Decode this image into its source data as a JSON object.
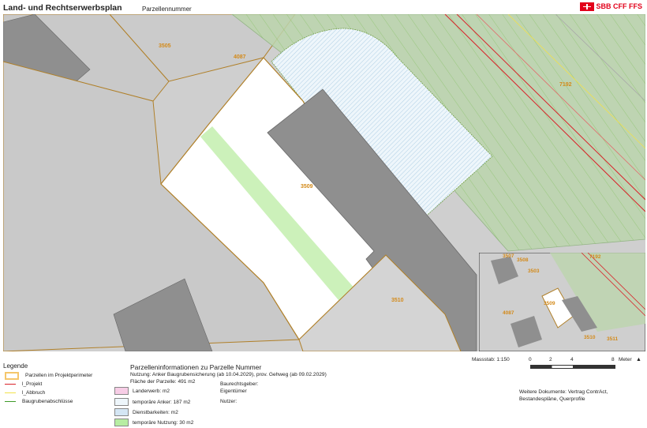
{
  "header": {
    "title": "Land- und Rechtserwerbsplan",
    "parcel_label": "Parzellennummer",
    "logo_text": "SBB CFF FFS"
  },
  "map": {
    "parcel_labels": [
      "3505",
      "4087",
      "7192",
      "3509",
      "3510"
    ],
    "inset_labels": [
      "3507",
      "3508",
      "3503",
      "7192",
      "3509",
      "4087",
      "3510",
      "3511"
    ]
  },
  "legend": {
    "title": "Legende",
    "items": [
      {
        "label": "Parzellen im Projektperimeter",
        "color": "#f5c66b",
        "style": "box"
      },
      {
        "label": "l_Projekt",
        "color": "#d9232a",
        "style": "line"
      },
      {
        "label": "l_Abbruch",
        "color": "#f2e14a",
        "style": "line"
      },
      {
        "label": "Baugrubenabschlüsse",
        "color": "#3f9a2a",
        "style": "line"
      }
    ]
  },
  "parcel_info": {
    "title": "Parzelleninformationen zu Parzelle Nummer",
    "usage": "Nutzung: Anker Baugrubensicherung (ab 10.04.2029),  prov. Gehweg (ab 09.02.2029)",
    "area": "Fläche der Parzelle: 491 m2",
    "attributes": [
      {
        "label": "Landerwerb:  m2",
        "color": "#f7cde6"
      },
      {
        "label": "temporäre Anker: 187 m2",
        "color": "#eef6fb"
      },
      {
        "label": "Dienstbarkeiten:  m2",
        "color": "#d4e6f4"
      },
      {
        "label": "temporäre Nutzung: 30 m2",
        "color": "#b7eda2"
      }
    ],
    "builder": "Baurechtsgeber:",
    "owner": "Eigentümer",
    "user": "Nutzer:"
  },
  "scale": {
    "label": "Massstab: 1:150",
    "ticks": [
      "0",
      "2",
      "4",
      "8"
    ],
    "unit": "Meter"
  },
  "docs": {
    "text": "Weitere Dokumente: Vertrag ContrAct, Bestandespläne, Querprofile"
  }
}
